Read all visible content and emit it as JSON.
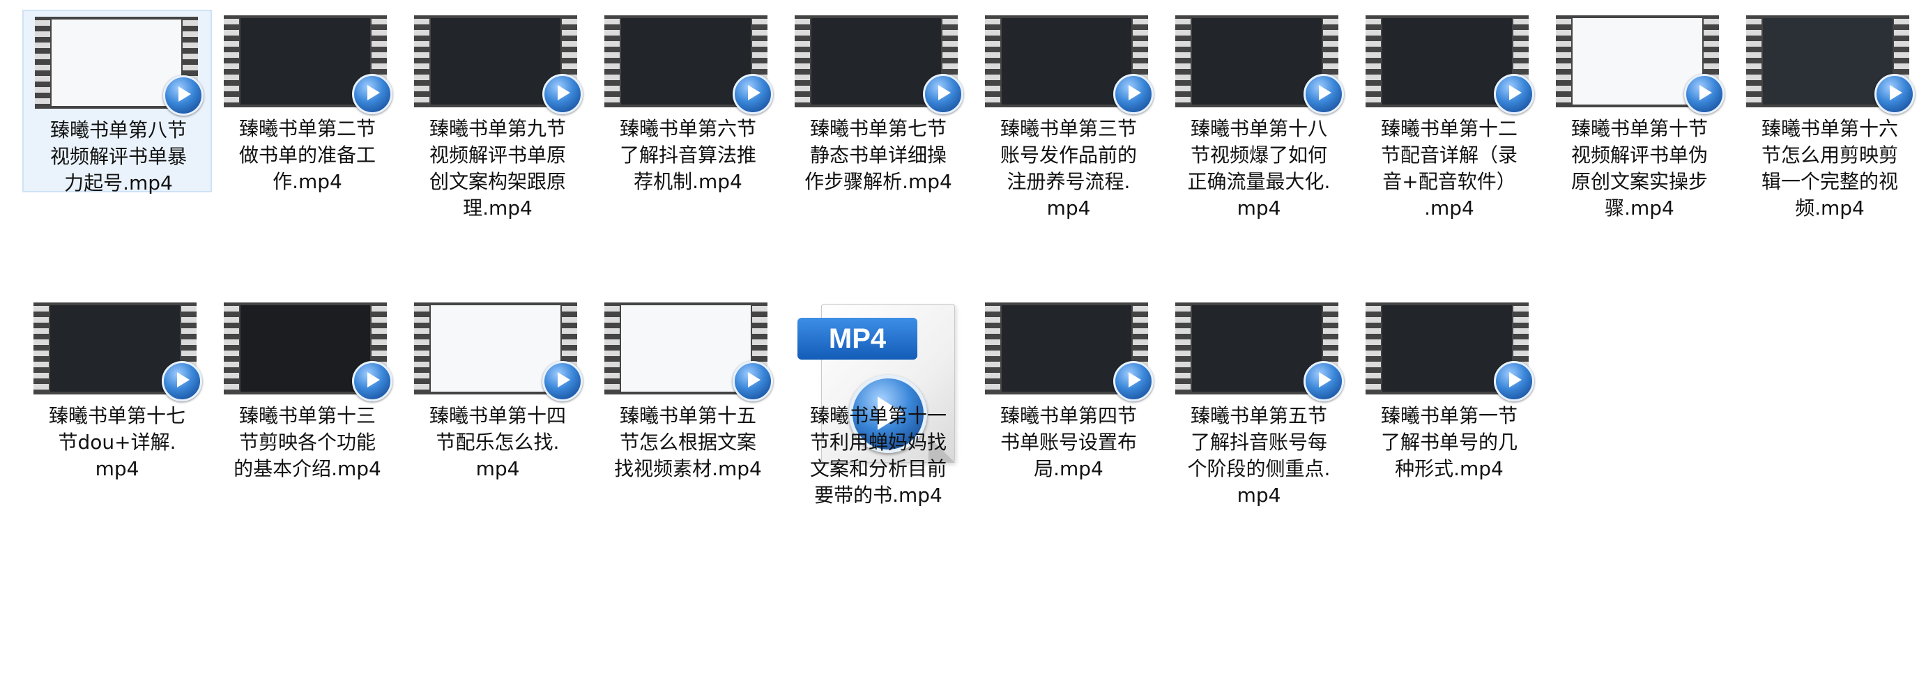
{
  "files": [
    {
      "name": "臻曦书单第八节视频解评书单暴力起号.mp4",
      "label": "臻曦书单第八节\n视频解评书单暴\n力起号.mp4",
      "preview": "light",
      "selected": true
    },
    {
      "name": "臻曦书单第二节做书单的准备工作.mp4",
      "label": "臻曦书单第二节\n做书单的准备工\n作.mp4",
      "preview": "dark",
      "selected": false
    },
    {
      "name": "臻曦书单第九节视频解评书单原创文案构架跟原理.mp4",
      "label": "臻曦书单第九节\n视频解评书单原\n创文案构架跟原\n理.mp4",
      "preview": "dark",
      "selected": false
    },
    {
      "name": "臻曦书单第六节了解抖音算法推荐机制.mp4",
      "label": "臻曦书单第六节\n了解抖音算法推\n荐机制.mp4",
      "preview": "dark",
      "selected": false
    },
    {
      "name": "臻曦书单第七节静态书单详细操作步骤解析.mp4",
      "label": "臻曦书单第七节\n静态书单详细操\n作步骤解析.mp4",
      "preview": "dark",
      "selected": false
    },
    {
      "name": "臻曦书单第三节账号发作品前的注册养号流程.mp4",
      "label": "臻曦书单第三节\n账号发作品前的\n注册养号流程.\nmp4",
      "preview": "dark",
      "selected": false
    },
    {
      "name": "臻曦书单第十八节视频爆了如何正确流量最大化.mp4",
      "label": "臻曦书单第十八\n节视频爆了如何\n正确流量最大化.\nmp4",
      "preview": "dark",
      "selected": false
    },
    {
      "name": "臻曦书单第十二节配音详解（录音+配音软件）.mp4",
      "label": "臻曦书单第十二\n节配音详解（录\n音+配音软件）\n.mp4",
      "preview": "dark",
      "selected": false
    },
    {
      "name": "臻曦书单第十节视频解评书单伪原创文案实操步骤.mp4",
      "label": "臻曦书单第十节\n视频解评书单伪\n原创文案实操步\n骤.mp4",
      "preview": "light",
      "selected": false
    },
    {
      "name": "臻曦书单第十六节怎么用剪映剪辑一个完整的视频.mp4",
      "label": "臻曦书单第十六\n节怎么用剪映剪\n辑一个完整的视\n频.mp4",
      "preview": "desk",
      "selected": false
    },
    {
      "name": "臻曦书单第十七节dou+详解.mp4",
      "label": "臻曦书单第十七\n节dou+详解.\nmp4",
      "preview": "dark",
      "selected": false
    },
    {
      "name": "臻曦书单第十三节剪映各个功能的基本介绍.mp4",
      "label": "臻曦书单第十三\n节剪映各个功能\n的基本介绍.mp4",
      "preview": "edit",
      "selected": false
    },
    {
      "name": "臻曦书单第十四节配乐怎么找.mp4",
      "label": "臻曦书单第十四\n节配乐怎么找.\nmp4",
      "preview": "light",
      "selected": false
    },
    {
      "name": "臻曦书单第十五节怎么根据文案找视频素材.mp4",
      "label": "臻曦书单第十五\n节怎么根据文案\n找视频素材.mp4",
      "preview": "light",
      "selected": false
    },
    {
      "name": "臻曦书单第十一节利用蝉妈妈找文案和分析目前要带的书.mp4",
      "label": "臻曦书单第十一\n节利用蝉妈妈找\n文案和分析目前\n要带的书.mp4",
      "preview": "icon",
      "icon_text": "MP4",
      "selected": false
    },
    {
      "name": "臻曦书单第四节书单账号设置布局.mp4",
      "label": "臻曦书单第四节\n书单账号设置布\n局.mp4",
      "preview": "dark",
      "selected": false
    },
    {
      "name": "臻曦书单第五节了解抖音账号每个阶段的侧重点.mp4",
      "label": "臻曦书单第五节\n了解抖音账号每\n个阶段的侧重点.\nmp4",
      "preview": "dark",
      "selected": false
    },
    {
      "name": "臻曦书单第一节了解书单号的几种形式.mp4",
      "label": "臻曦书单第一节\n了解书单号的几\n种形式.mp4",
      "preview": "dark",
      "selected": false
    }
  ]
}
